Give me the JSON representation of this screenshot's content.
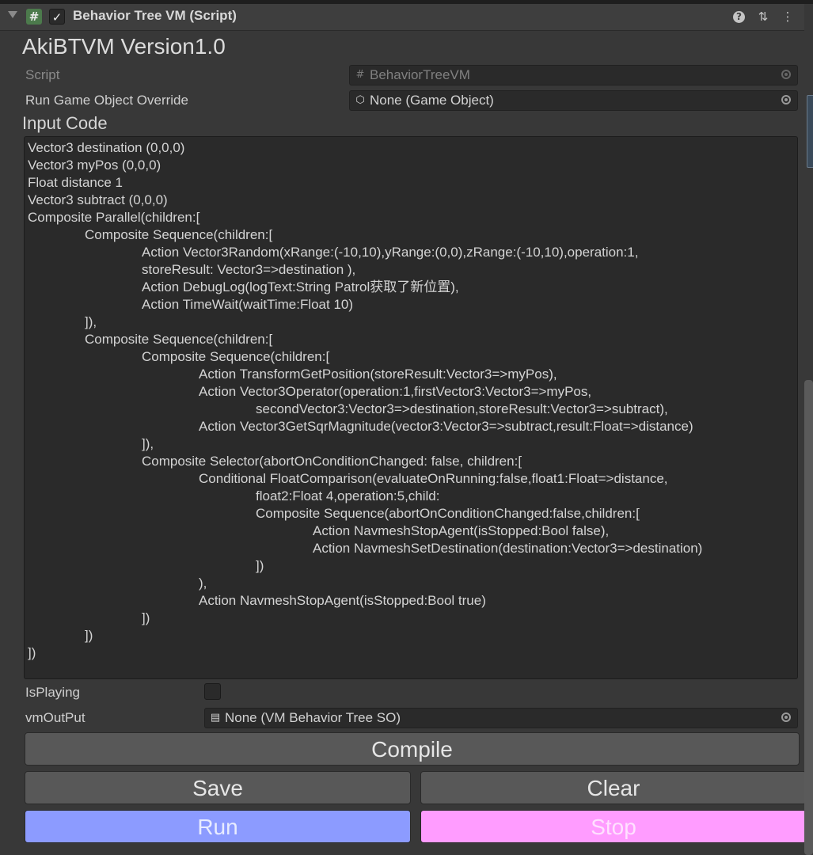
{
  "component": {
    "title": "Behavior Tree VM (Script)",
    "enabled": true,
    "icons": [
      "hash-icon",
      "help-icon",
      "preset-icon",
      "menu-icon"
    ]
  },
  "version_title": "AkiBTVM Version1.0",
  "script_field": {
    "label": "Script",
    "value": "BehaviorTreeVM",
    "icon": "script-hash-icon"
  },
  "run_game_object_override": {
    "label": "Run Game Object Override",
    "value": "None (Game Object)",
    "icon": "cube-icon"
  },
  "input_code": {
    "label": "Input Code",
    "lines": [
      "Vector3 destination (0,0,0)",
      "Vector3 myPos (0,0,0)",
      "Float distance 1",
      "Vector3 subtract (0,0,0)",
      "Composite Parallel(children:[",
      "\t\tComposite Sequence(children:[",
      "\t\t\t\tAction Vector3Random(xRange:(-10,10),yRange:(0,0),zRange:(-10,10),operation:1,",
      "\t\t\t\tstoreResult: Vector3=>destination ),",
      "\t\t\t\tAction DebugLog(logText:String Patrol获取了新位置),",
      "\t\t\t\tAction TimeWait(waitTime:Float 10)",
      "\t\t]),",
      "\t\tComposite Sequence(children:[",
      "\t\t\t\tComposite Sequence(children:[",
      "\t\t\t\t\t\tAction TransformGetPosition(storeResult:Vector3=>myPos),",
      "\t\t\t\t\t\tAction Vector3Operator(operation:1,firstVector3:Vector3=>myPos,",
      "\t\t\t\t\t\t\t\tsecondVector3:Vector3=>destination,storeResult:Vector3=>subtract),",
      "\t\t\t\t\t\tAction Vector3GetSqrMagnitude(vector3:Vector3=>subtract,result:Float=>distance)",
      "\t\t\t\t]),",
      "\t\t\t\tComposite Selector(abortOnConditionChanged: false, children:[",
      "\t\t\t\t\t\tConditional FloatComparison(evaluateOnRunning:false,float1:Float=>distance,",
      "\t\t\t\t\t\t\t\tfloat2:Float 4,operation:5,child:",
      "\t\t\t\t\t\t\t\tComposite Sequence(abortOnConditionChanged:false,children:[",
      "\t\t\t\t\t\t\t\t\t\tAction NavmeshStopAgent(isStopped:Bool false),",
      "\t\t\t\t\t\t\t\t\t\tAction NavmeshSetDestination(destination:Vector3=>destination)",
      "\t\t\t\t\t\t\t\t])",
      "\t\t\t\t\t\t),",
      "\t\t\t\t\t\tAction NavmeshStopAgent(isStopped:Bool true)",
      "\t\t\t\t])",
      "\t\t])",
      "])"
    ]
  },
  "is_playing": {
    "label": "IsPlaying",
    "checked": false
  },
  "vm_output": {
    "label": "vmOutPut",
    "value": "None (VM Behavior Tree SO)",
    "icon": "document-icon"
  },
  "buttons": {
    "compile": "Compile",
    "save": "Save",
    "clear": "Clear",
    "run": "Run",
    "stop": "Stop"
  },
  "colors": {
    "run": "#8c9bff",
    "stop": "#ff9cff",
    "background": "#383838",
    "field": "#2a2a2a"
  }
}
